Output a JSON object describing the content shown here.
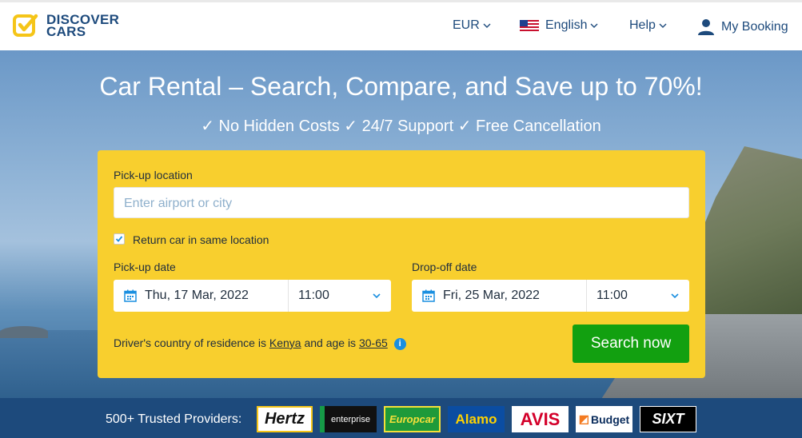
{
  "header": {
    "logo_line1": "DISCOVER",
    "logo_line2": "CARS",
    "currency": "EUR",
    "language": "English",
    "help": "Help",
    "my_booking": "My Booking"
  },
  "hero": {
    "title": "Car Rental – Search, Compare, and Save up to 70%!",
    "subtitle": "✓ No Hidden Costs ✓ 24/7 Support ✓ Free Cancellation"
  },
  "search": {
    "pickup_location_label": "Pick-up location",
    "pickup_location_placeholder": "Enter airport or city",
    "return_same_label": "Return car in same location",
    "return_same_checked": true,
    "pickup_date_label": "Pick-up date",
    "pickup_date": "Thu, 17 Mar, 2022",
    "pickup_time": "11:00",
    "dropoff_date_label": "Drop-off date",
    "dropoff_date": "Fri, 25 Mar, 2022",
    "dropoff_time": "11:00",
    "driver_prefix": "Driver's country of residence is",
    "driver_country": "Kenya",
    "driver_mid": "and age is",
    "driver_age": "30-65",
    "search_button": "Search now"
  },
  "providers": {
    "label": "500+ Trusted Providers:",
    "items": [
      "Hertz",
      "enterprise",
      "Europcar",
      "Alamo",
      "AVIS",
      "Budget",
      "SIXT"
    ]
  },
  "colors": {
    "brand_blue": "#1d4a7c",
    "form_yellow": "#f8cf2e",
    "search_green": "#12a010",
    "logo_yellow": "#f5c518"
  }
}
